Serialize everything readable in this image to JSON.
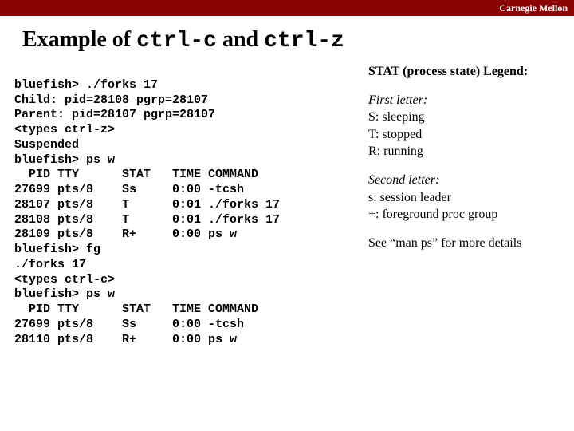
{
  "topbar": {
    "label": "Carnegie Mellon"
  },
  "title": {
    "t1": "Example of ",
    "code1": "ctrl-c",
    "t2": " and ",
    "code2": "ctrl-z"
  },
  "terminal": {
    "lines": [
      "bluefish> ./forks 17",
      "Child: pid=28108 pgrp=28107",
      "Parent: pid=28107 pgrp=28107",
      "<types ctrl-z>",
      "Suspended",
      "bluefish> ps w",
      "  PID TTY      STAT   TIME COMMAND",
      "27699 pts/8    Ss     0:00 -tcsh",
      "28107 pts/8    T      0:01 ./forks 17",
      "28108 pts/8    T      0:01 ./forks 17",
      "28109 pts/8    R+     0:00 ps w",
      "bluefish> fg",
      "./forks 17",
      "<types ctrl-c>",
      "bluefish> ps w",
      "  PID TTY      STAT   TIME COMMAND",
      "27699 pts/8    Ss     0:00 -tcsh",
      "28110 pts/8    R+     0:00 ps w"
    ]
  },
  "legend": {
    "heading": "STAT (process state) Legend:",
    "first": {
      "label": "First letter:",
      "S": "S: sleeping",
      "T": "T: stopped",
      "R": "R: running"
    },
    "second": {
      "label": "Second letter:",
      "s": "s: session leader",
      "plus": "+: foreground proc group"
    },
    "note": "See “man ps” for more details"
  }
}
